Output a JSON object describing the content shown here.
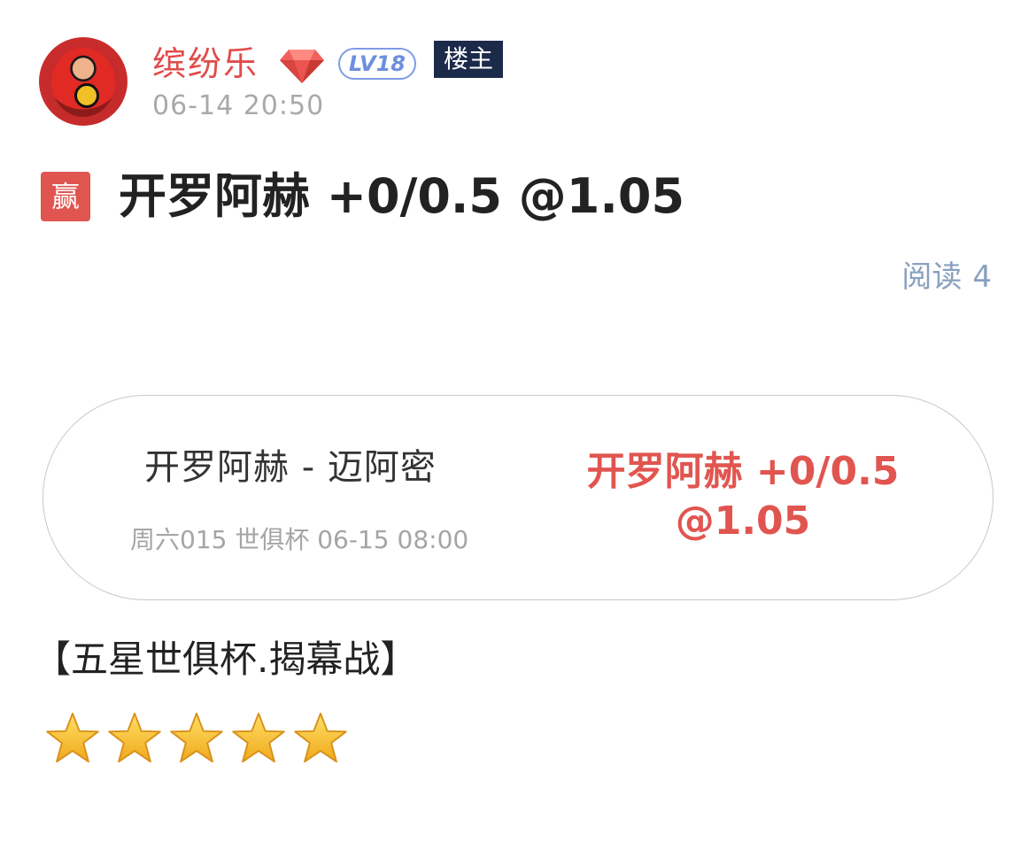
{
  "header": {
    "username": "缤纷乐",
    "level": "LV18",
    "owner_tag": "楼主",
    "timestamp": "06-14 20:50",
    "icons": [
      "avatar",
      "gem-icon"
    ]
  },
  "post": {
    "result_badge": "赢",
    "title": "开罗阿赫 +0/0.5 @1.05",
    "read_label": "阅读",
    "read_count": "4"
  },
  "bet_card": {
    "teams": "开罗阿赫 - 迈阿密",
    "match_info": "周六015 世俱杯 06-15 08:00",
    "pick_line1": "开罗阿赫 +0/0.5",
    "pick_line2": "@1.05"
  },
  "body": {
    "heading": "【五星世俱杯.揭幕战】",
    "rating_stars": 5
  },
  "colors": {
    "accent_red": "#e15550",
    "level_blue": "#7f9be6",
    "owner_navy": "#1c2a4a",
    "muted_gray": "#a9a9a9",
    "read_blue": "#8aa0bf",
    "star_yellow": "#f5c518"
  }
}
